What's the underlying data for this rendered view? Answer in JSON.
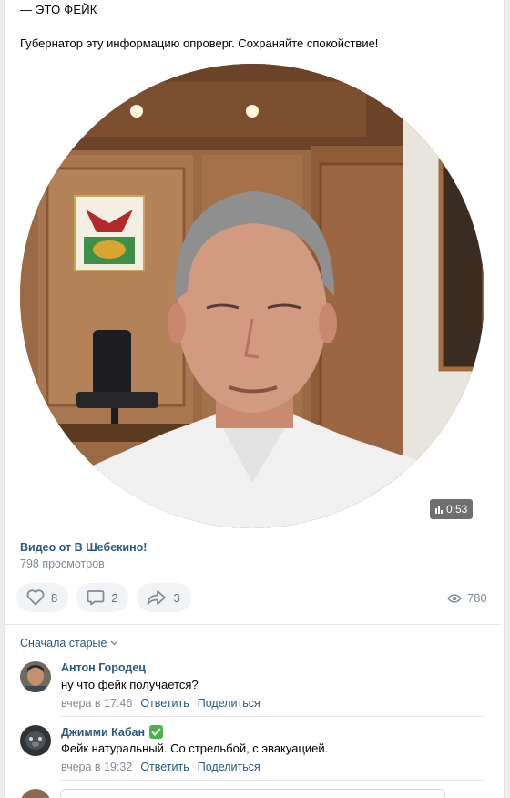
{
  "post": {
    "header_line": "— ЭТО ФЕЙК",
    "text": "Губернатор эту информацию опроверг. Сохраняйте спокойствие!"
  },
  "video": {
    "duration": "0:53",
    "title": "Видео от В Шебекино!",
    "views": "798 просмотров"
  },
  "actions": {
    "likes": "8",
    "comments": "2",
    "shares": "3",
    "views": "780",
    "like_icon": "heart-icon",
    "comment_icon": "comment-icon",
    "share_icon": "share-icon",
    "views_icon": "eye-icon"
  },
  "comments_sort": {
    "label": "Сначала старые"
  },
  "comments": [
    {
      "author": "Антон Городец",
      "text": "ну что фейк получается?",
      "time": "вчера в 17:46",
      "reply": "Ответить",
      "share": "Поделиться",
      "verified": false
    },
    {
      "author": "Джимми Кабан",
      "text": "Фейк натуральный. Со стрельбой, с эвакуацией.",
      "time": "вчера в 19:32",
      "reply": "Ответить",
      "share": "Поделиться",
      "verified": true
    }
  ],
  "colors": {
    "link": "#2a5885",
    "muted": "#818c99",
    "verified": "#4bb34b",
    "button_bg": "#f2f3f5"
  }
}
